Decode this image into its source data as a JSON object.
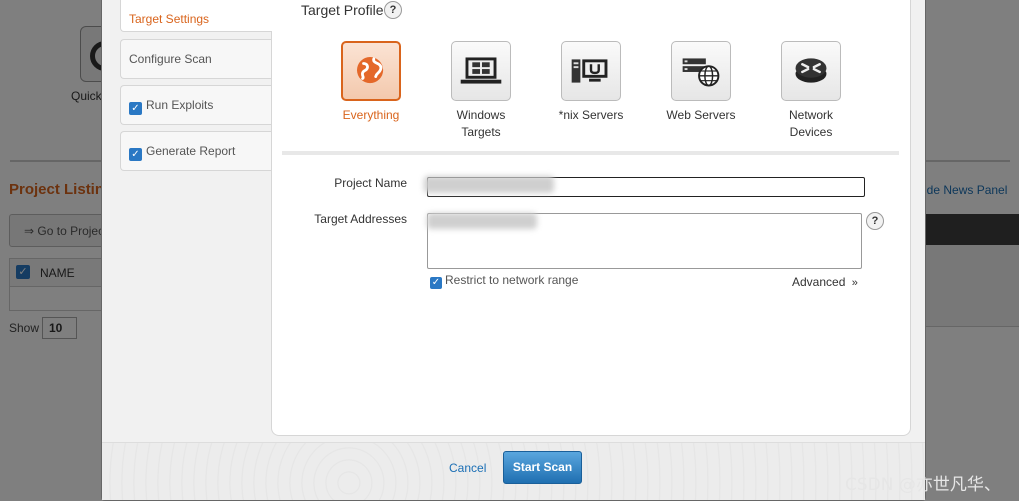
{
  "background": {
    "quick_label": "Quick",
    "project_listing_title": "Project Listing",
    "goto_button": "⇒ Go to Project",
    "table_header_name": "NAME",
    "show_label": "Show",
    "show_value": "10",
    "s_fragment": "S",
    "news_link": "ide News Panel"
  },
  "sidebar": {
    "steps": [
      {
        "label": "Target Settings",
        "active": true
      },
      {
        "label": "Configure Scan",
        "active": false
      },
      {
        "label": "Run Exploits",
        "checked": true
      },
      {
        "label": "Generate Report",
        "checked": true
      }
    ]
  },
  "target_profile": {
    "title": "Target Profile",
    "help": "?",
    "profiles": [
      {
        "label": "Everything",
        "icon": "globe-icon",
        "selected": true
      },
      {
        "label": "Windows Targets",
        "icon": "laptop-windows-icon",
        "selected": false
      },
      {
        "label": "*nix Servers",
        "icon": "unix-server-icon",
        "selected": false
      },
      {
        "label": "Web Servers",
        "icon": "web-server-icon",
        "selected": false
      },
      {
        "label": "Network Devices",
        "icon": "router-icon",
        "selected": false
      }
    ]
  },
  "form": {
    "project_name_label": "Project Name",
    "target_addresses_label": "Target Addresses",
    "restrict_label": "Restrict to network range",
    "advanced_label": "Advanced",
    "help": "?"
  },
  "footer": {
    "cancel": "Cancel",
    "start_scan": "Start Scan"
  },
  "watermark": "CSDN @亦世凡华、",
  "colors": {
    "accent": "#d9641c",
    "link": "#1b6fb5",
    "primary_button": "#2a7fc2"
  }
}
